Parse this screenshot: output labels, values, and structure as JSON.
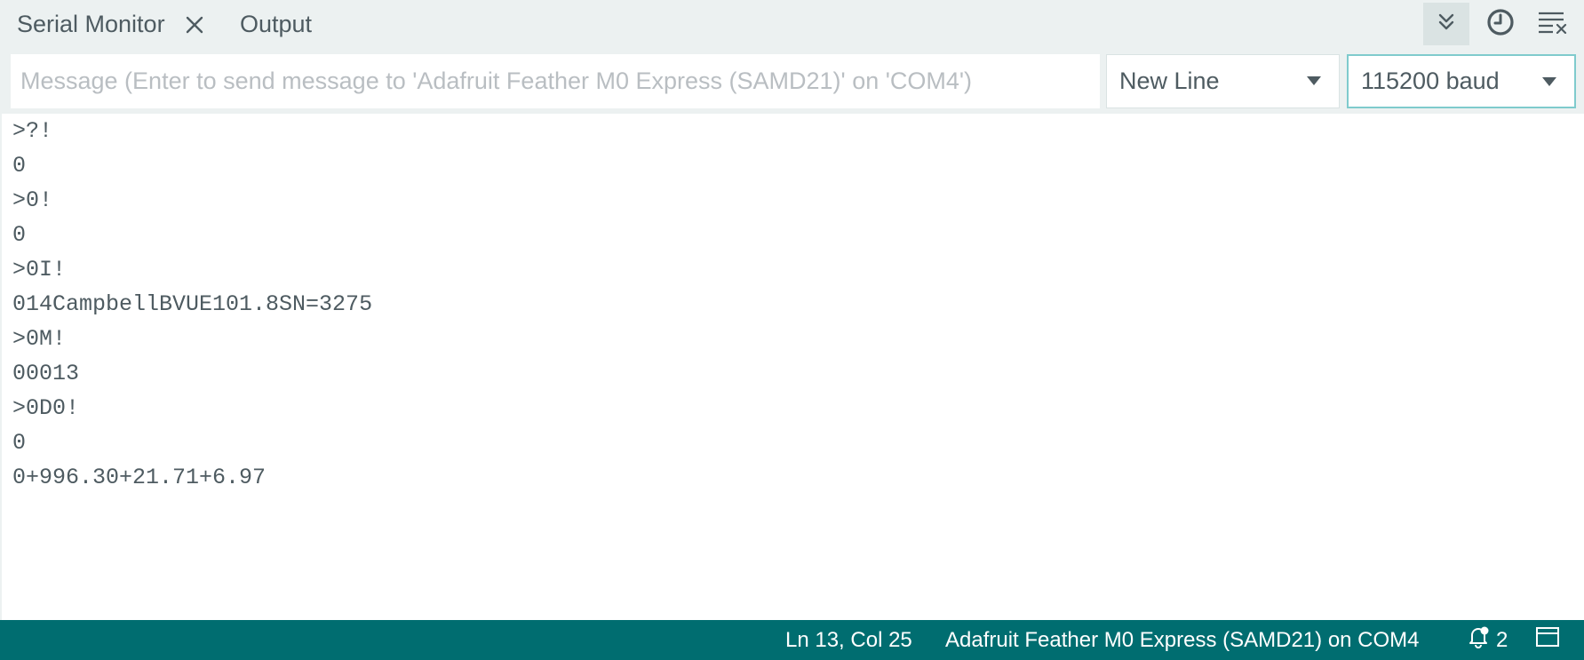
{
  "tabs": {
    "serial_monitor": "Serial Monitor",
    "output": "Output"
  },
  "toolbar": {
    "autoscroll_icon": "double-chevron-down-icon",
    "timestamp_icon": "clock-icon",
    "clear_icon": "clear-output-icon"
  },
  "message": {
    "placeholder": "Message (Enter to send message to 'Adafruit Feather M0 Express (SAMD21)' on 'COM4')",
    "value": ""
  },
  "line_ending": {
    "selected": "New Line"
  },
  "baud_rate": {
    "selected": "115200 baud"
  },
  "output_lines": [
    ">?!",
    "0",
    ">0!",
    "0",
    ">0I!",
    "014CampbellBVUE101.8SN=3275",
    ">0M!",
    "00013",
    ">0D0!",
    "0",
    "0+996.30+21.71+6.97"
  ],
  "statusbar": {
    "cursor_position": "Ln 13, Col 25",
    "board": "Adafruit Feather M0 Express (SAMD21) on COM4",
    "notification_count": "2"
  },
  "colors": {
    "tabbar_bg": "#ecf1f1",
    "text": "#4e5b61",
    "statusbar_bg": "#006d70",
    "baud_border": "#7fcbcd"
  }
}
